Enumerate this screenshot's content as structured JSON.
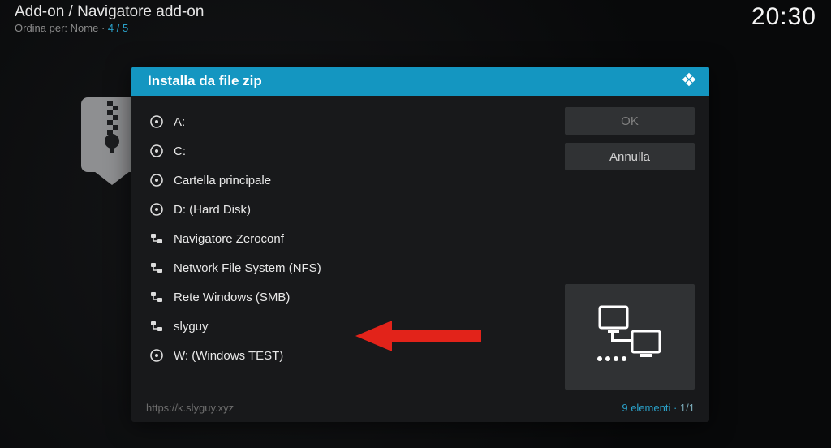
{
  "header": {
    "breadcrumb": "Add-on / Navigatore add-on",
    "sort_label": "Ordina per: Nome",
    "position": "4 / 5",
    "clock": "20:30"
  },
  "dialog": {
    "title": "Installa da file zip",
    "buttons": {
      "ok": "OK",
      "cancel": "Annulla"
    },
    "items": [
      {
        "icon": "disk",
        "label": "A:"
      },
      {
        "icon": "disk",
        "label": "C:"
      },
      {
        "icon": "disk",
        "label": "Cartella principale"
      },
      {
        "icon": "disk",
        "label": "D: (Hard Disk)"
      },
      {
        "icon": "network",
        "label": "Navigatore Zeroconf"
      },
      {
        "icon": "network",
        "label": "Network File System (NFS)"
      },
      {
        "icon": "network",
        "label": "Rete Windows (SMB)"
      },
      {
        "icon": "network",
        "label": "slyguy"
      },
      {
        "icon": "disk",
        "label": "W: (Windows TEST)"
      }
    ],
    "footer": {
      "path": "https://k.slyguy.xyz",
      "count_label": "9 elementi",
      "page": "1/1"
    }
  },
  "annotation": {
    "arrow_target": "slyguy"
  }
}
